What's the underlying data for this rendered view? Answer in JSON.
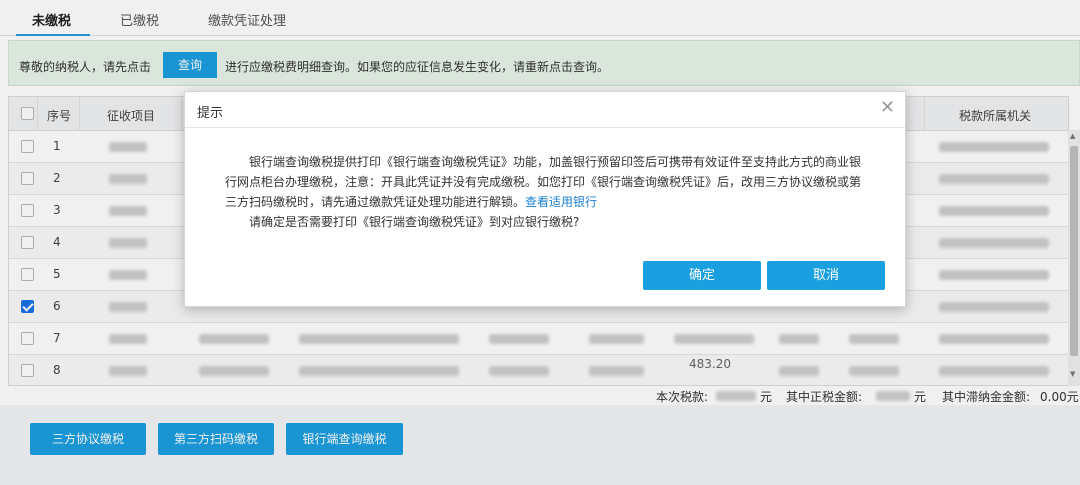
{
  "tabs": [
    {
      "label": "未缴税",
      "active": true
    },
    {
      "label": "已缴税",
      "active": false
    },
    {
      "label": "缴款凭证处理",
      "active": false
    }
  ],
  "notice": {
    "text_before": "尊敬的纳税人，请先点击",
    "query_button": "查询",
    "text_after": "进行应缴税费明细查询。如果您的应征信息发生变化，请重新点击查询。"
  },
  "table": {
    "columns": [
      "序号",
      "征收项目",
      "税款所属机关"
    ],
    "rows": [
      {
        "seq": "1",
        "checked": false
      },
      {
        "seq": "2",
        "checked": false
      },
      {
        "seq": "3",
        "checked": false
      },
      {
        "seq": "4",
        "checked": false
      },
      {
        "seq": "5",
        "checked": false
      },
      {
        "seq": "6",
        "checked": true
      },
      {
        "seq": "7",
        "checked": false
      },
      {
        "seq": "8",
        "checked": false
      }
    ],
    "row8_amount": "483.20"
  },
  "summary": {
    "this_tax_label": "本次税款:",
    "this_tax_unit": "元",
    "principal_label": "其中正税金额:",
    "principal_unit": "元",
    "late_fee_label": "其中滞纳金金额:",
    "late_fee_value": "0.00元"
  },
  "actions": [
    {
      "label": "三方协议缴税"
    },
    {
      "label": "第三方扫码缴税"
    },
    {
      "label": "银行端查询缴税"
    }
  ],
  "modal": {
    "title": "提示",
    "paragraph1": "银行端查询缴税提供打印《银行端查询缴税凭证》功能，加盖银行预留印签后可携带有效证件至支持此方式的商业银行网点柜台办理缴税，注意：开具此凭证并没有完成缴税。如您打印《银行端查询缴税凭证》后，改用三方协议缴税或第三方扫码缴税时，请先通过缴款凭证处理功能进行解锁。",
    "link": "查看适用银行",
    "paragraph2": "请确定是否需要打印《银行端查询缴税凭证》到对应银行缴税?",
    "confirm": "确定",
    "cancel": "取消",
    "close_icon": "close-icon"
  },
  "colors": {
    "primary": "#1a9fe0",
    "notice_bg": "#e8f4ea",
    "link": "#1a7fd4",
    "checkbox_checked": "#1a73e8"
  }
}
